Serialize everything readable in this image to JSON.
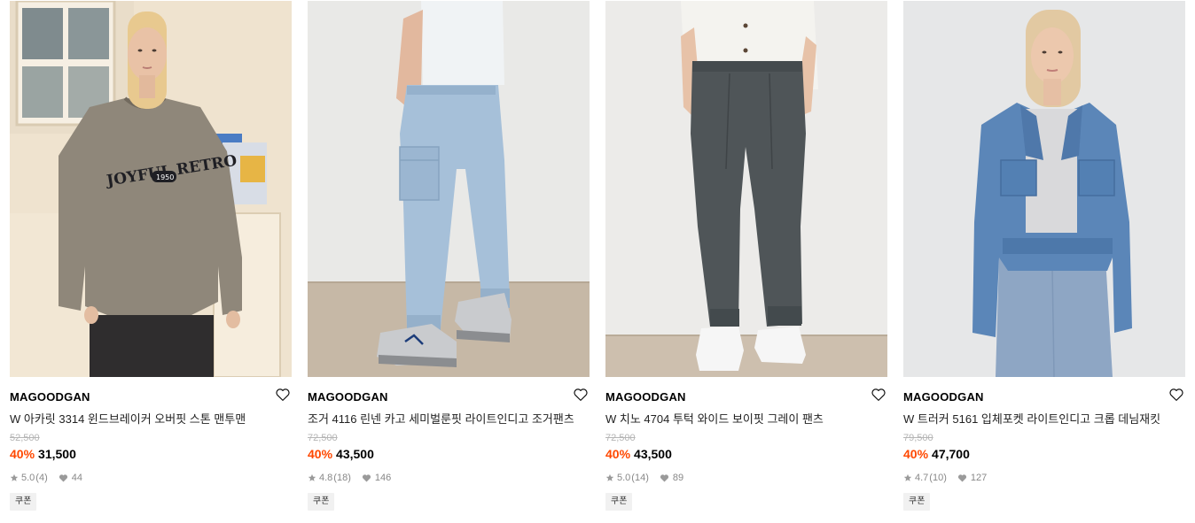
{
  "products": [
    {
      "brand": "MAGOODGAN",
      "name": "W 아카릿 3314 윈드브레이커 오버핏 스톤 맨투맨",
      "original_price": "52,500",
      "discount": "40%",
      "price": "31,500",
      "rating": "5.0",
      "reviews": "(4)",
      "likes": "44",
      "coupon": "쿠폰",
      "print_text": "JOYFUL RETRO",
      "print_badge": "1950"
    },
    {
      "brand": "MAGOODGAN",
      "name": "조거 4116 린넨 카고 세미벌룬핏 라이트인디고 조거팬츠",
      "original_price": "72,500",
      "discount": "40%",
      "price": "43,500",
      "rating": "4.8",
      "reviews": "(18)",
      "likes": "146",
      "coupon": "쿠폰"
    },
    {
      "brand": "MAGOODGAN",
      "name": "W 치노 4704 투턱 와이드 보이핏 그레이 팬츠",
      "original_price": "72,500",
      "discount": "40%",
      "price": "43,500",
      "rating": "5.0",
      "reviews": "(14)",
      "likes": "89",
      "coupon": "쿠폰"
    },
    {
      "brand": "MAGOODGAN",
      "name": "W 트러커 5161 입체포켓 라이트인디고 크롭 데님재킷",
      "original_price": "79,500",
      "discount": "40%",
      "price": "47,700",
      "rating": "4.7",
      "reviews": "(10)",
      "likes": "127",
      "coupon": "쿠폰"
    }
  ],
  "colors": {
    "discount": "#ff4800",
    "muted": "#999999",
    "strike": "#b5b5b5",
    "coupon_bg": "#f1f1f1"
  },
  "icons": {
    "wishlist": "heart-outline-icon",
    "rating": "star-icon",
    "likes": "heart-filled-icon"
  }
}
